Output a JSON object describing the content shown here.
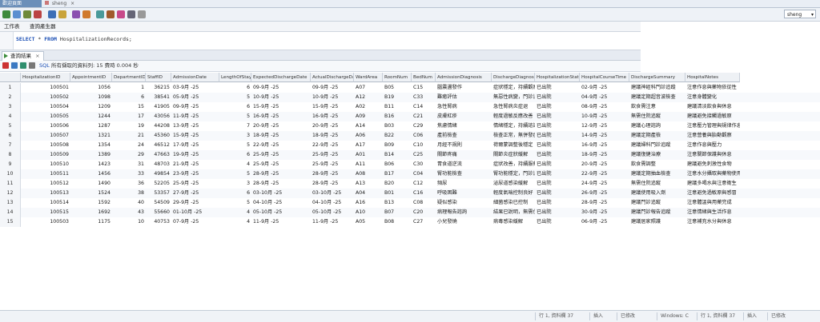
{
  "tabs": {
    "welcome": "歡迎頁面",
    "sheng": "sheng"
  },
  "connection": {
    "selected": "sheng"
  },
  "subtabs": [
    "工作表",
    "查詢產生器"
  ],
  "editor": {
    "sql_keyword_select": "SELECT",
    "sql_star": "*",
    "sql_keyword_from": "FROM",
    "sql_table": "HospitalizationRecords;"
  },
  "results": {
    "tab_label": "查詢結果",
    "sql_label": "SQL",
    "status": "所有擷取的資料列: 15 費時 0.004 秒",
    "columns": [
      "HospitalizationID",
      "AppointmentID",
      "DepartmentID",
      "StaffID",
      "AdmissionDate",
      "LengthOfStay",
      "ExpectedDischargeDate",
      "ActualDischargeDate",
      "WardArea",
      "RoomNum",
      "BedNum",
      "AdmissionDiagnosis",
      "DischargeDiagnosis",
      "HospitalizationStatus",
      "HospitalCourseTime",
      "DischargeSummary",
      "HospitalNotes"
    ],
    "rows": [
      [
        "1",
        "100501",
        "1056",
        "1",
        "36215",
        "03-9月 -25",
        "6",
        "09-9月 -25",
        "09-9月 -25",
        "A07",
        "B05",
        "C15",
        "腦震盪發作",
        "症狀穩定，持續觀察",
        "已出院",
        "02-9月 -25",
        "建議神經科門診追蹤",
        "注意作息與藥物依從性"
      ],
      [
        "2",
        "100502",
        "1098",
        "6",
        "38541",
        "05-9月 -25",
        "5",
        "10-9月 -25",
        "10-9月 -25",
        "A12",
        "B19",
        "C33",
        "難癒評估",
        "無惡性病變，門診追蹤",
        "已出院",
        "04-9月 -25",
        "建議定期超音波檢查",
        "注意身體變化"
      ],
      [
        "3",
        "100504",
        "1209",
        "15",
        "41905",
        "09-9月 -25",
        "6",
        "15-9月 -25",
        "15-9月 -25",
        "A02",
        "B11",
        "C14",
        "急性腎病",
        "急性腎病炎症退",
        "已出院",
        "08-9月 -25",
        "飲食需注意",
        "建議清淡飲食與休息"
      ],
      [
        "4",
        "100505",
        "1244",
        "17",
        "43056",
        "11-9月 -25",
        "5",
        "16-9月 -25",
        "16-9月 -25",
        "A09",
        "B16",
        "C21",
        "皮膚紅疹",
        "輕度過敏反應改善",
        "已出院",
        "10-9月 -25",
        "無需住院追蹤",
        "建議避免接觸過敏原"
      ],
      [
        "5",
        "100506",
        "1287",
        "19",
        "44208",
        "13-9月 -25",
        "7",
        "20-9月 -25",
        "20-9月 -25",
        "A14",
        "B03",
        "C29",
        "焦慮情緒",
        "情緒穩定，持續諮詢",
        "已出院",
        "12-9月 -25",
        "建議心理諮詢",
        "注意壓力管理與規律作息"
      ],
      [
        "6",
        "100507",
        "1321",
        "21",
        "45360",
        "15-9月 -25",
        "3",
        "18-9月 -25",
        "18-9月 -25",
        "A06",
        "B22",
        "C06",
        "產前檢查",
        "檢查正常，無併發症",
        "已出院",
        "14-9月 -25",
        "建議定期產檢",
        "注意營養與胎動觀察"
      ],
      [
        "7",
        "100508",
        "1354",
        "24",
        "46512",
        "17-9月 -25",
        "5",
        "22-9月 -25",
        "22-9月 -25",
        "A17",
        "B09",
        "C10",
        "月經不規則",
        "荷爾蒙調整後穩定",
        "已出院",
        "16-9月 -25",
        "建議婦科門診追蹤",
        "注意作息與壓力"
      ],
      [
        "8",
        "100509",
        "1389",
        "29",
        "47663",
        "19-9月 -25",
        "6",
        "25-9月 -25",
        "25-9月 -25",
        "A01",
        "B14",
        "C25",
        "關節疼痛",
        "關節炎症狀緩解",
        "已出院",
        "18-9月 -25",
        "建議復健治療",
        "注意關節保護與休息"
      ],
      [
        "9",
        "100510",
        "1423",
        "31",
        "48703",
        "21-9月 -25",
        "4",
        "25-9月 -25",
        "25-9月 -25",
        "A11",
        "B06",
        "C30",
        "胃食道逆流",
        "症狀改善，持續服藥",
        "已出院",
        "20-9月 -25",
        "飲食需調整",
        "建議避免刺激性食物"
      ],
      [
        "10",
        "100511",
        "1456",
        "33",
        "49854",
        "23-9月 -25",
        "5",
        "28-9月 -25",
        "28-9月 -25",
        "A08",
        "B17",
        "C04",
        "腎功能檢查",
        "腎功能穩定，門診追蹤",
        "已出院",
        "22-9月 -25",
        "建議定期抽血檢查",
        "注意水分攝取與藥物使用"
      ],
      [
        "11",
        "100512",
        "1490",
        "36",
        "52205",
        "25-9月 -25",
        "3",
        "28-9月 -25",
        "28-9月 -25",
        "A13",
        "B20",
        "C12",
        "頻尿",
        "泌尿道感染緩解",
        "已出院",
        "24-9月 -25",
        "無需住院追蹤",
        "建議多喝水與注意衛生"
      ],
      [
        "12",
        "100513",
        "1524",
        "38",
        "53357",
        "27-9月 -25",
        "6",
        "03-10月 -25",
        "03-10月 -25",
        "A04",
        "B01",
        "C16",
        "呼吸困難",
        "輕度氣喘控制良好",
        "已出院",
        "26-9月 -25",
        "建議使用吸入劑",
        "注意避免過敏原與感冒"
      ],
      [
        "13",
        "100514",
        "1592",
        "40",
        "54509",
        "29-9月 -25",
        "5",
        "04-10月 -25",
        "04-10月 -25",
        "A16",
        "B13",
        "C08",
        "疑似感染",
        "細菌感染已控制",
        "已出院",
        "28-9月 -25",
        "建議門診追蹤",
        "注意體溫與用藥完成"
      ],
      [
        "14",
        "100515",
        "1692",
        "43",
        "55660",
        "01-10月 -25",
        "4",
        "05-10月 -25",
        "05-10月 -25",
        "A10",
        "B07",
        "C20",
        "病理報告諮詢",
        "結果已說明，無需住院",
        "已出院",
        "30-9月 -25",
        "建議門診報告追蹤",
        "注意情緒與生活作息"
      ],
      [
        "15",
        "100503",
        "1175",
        "10",
        "40753",
        "07-9月 -25",
        "4",
        "11-9月 -25",
        "11-9月 -25",
        "A05",
        "B08",
        "C27",
        "小兒發燒",
        "病毒感染緩解",
        "已出院",
        "06-9月 -25",
        "建議居家照護",
        "注意補充水分與休息"
      ]
    ]
  },
  "statusbar": {
    "left": "行 1, 資料欄 37",
    "insert": "插入",
    "modified": "已修改",
    "os": "Windows: C"
  }
}
